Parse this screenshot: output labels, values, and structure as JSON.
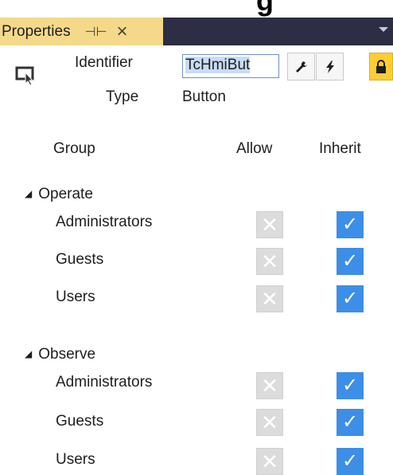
{
  "header": {
    "backdrop_text": "g",
    "tab_title": "Properties",
    "pin_icon": "pin-icon",
    "close_icon": "close-icon"
  },
  "control": {
    "icon": "button-control-icon",
    "identifier_label": "Identifier",
    "identifier_value": "TcHmiBut",
    "type_label": "Type",
    "type_value": "Button"
  },
  "toolbar": {
    "buttons": [
      {
        "name": "wrench-icon",
        "glyph": "🔧"
      },
      {
        "name": "lightning-icon",
        "glyph": "⚡"
      },
      {
        "name": "lock-icon",
        "glyph": "🔒"
      }
    ]
  },
  "columns": {
    "group": "Group",
    "allow": "Allow",
    "inherit": "Inherit"
  },
  "groups": [
    {
      "name": "Operate",
      "rows": [
        {
          "label": "Administrators",
          "allow": false,
          "inherit": true
        },
        {
          "label": "Guests",
          "allow": false,
          "inherit": true
        },
        {
          "label": "Users",
          "allow": false,
          "inherit": true
        }
      ]
    },
    {
      "name": "Observe",
      "rows": [
        {
          "label": "Administrators",
          "allow": false,
          "inherit": true
        },
        {
          "label": "Guests",
          "allow": false,
          "inherit": true
        },
        {
          "label": "Users",
          "allow": false,
          "inherit": true
        }
      ]
    }
  ],
  "colors": {
    "tab_bg": "#f5d98a",
    "titlebar_bg": "#2d2d44",
    "check_blue": "#3d8ee6",
    "disabled_gray": "#dcdcdc",
    "lock_yellow": "#ffcc33"
  }
}
